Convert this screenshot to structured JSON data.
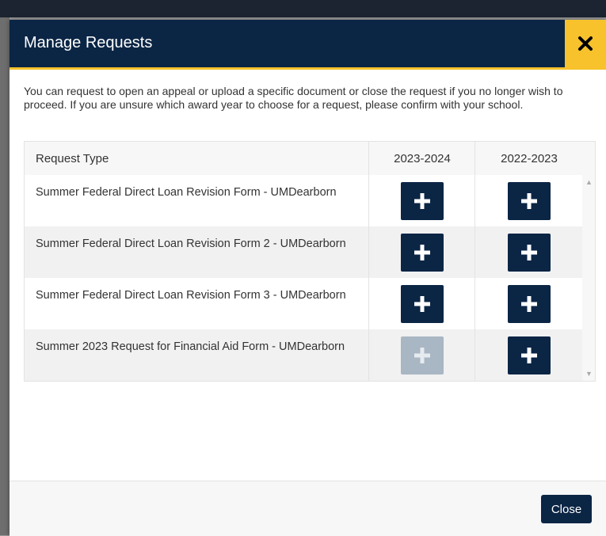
{
  "modal": {
    "title": "Manage Requests",
    "intro": "You can request to open an appeal or upload a specific document or close the request if you no longer wish to proceed. If you are unsure which award year to choose for a request, please confirm with your school.",
    "close_button": "Close"
  },
  "table": {
    "headers": [
      "Request Type",
      "2023-2024",
      "2022-2023"
    ],
    "rows": [
      {
        "label": "Summer Federal Direct Loan Revision Form - UMDearborn",
        "col1_enabled": true,
        "col2_enabled": true
      },
      {
        "label": "Summer Federal Direct Loan Revision Form 2 - UMDearborn",
        "col1_enabled": true,
        "col2_enabled": true
      },
      {
        "label": "Summer Federal Direct Loan Revision Form 3 - UMDearborn",
        "col1_enabled": true,
        "col2_enabled": true
      },
      {
        "label": "Summer 2023 Request for Financial Aid Form - UMDearborn",
        "col1_enabled": false,
        "col2_enabled": true
      }
    ]
  },
  "icons": {
    "close": "close-x-icon",
    "add": "plus-icon"
  },
  "colors": {
    "navy": "#0b2545",
    "gold": "#f7c22b",
    "disabled": "#a9b6c3"
  }
}
